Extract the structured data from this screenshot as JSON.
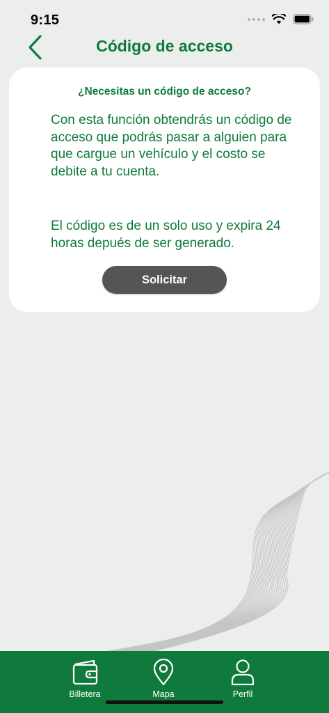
{
  "status_bar": {
    "time": "9:15"
  },
  "header": {
    "title": "Código de acceso",
    "back_icon": "chevron-left-icon"
  },
  "card": {
    "heading": "¿Necesitas un código de acceso?",
    "description_1": "Con esta función obtendrás un código de acceso que podrás pasar a alguien para que cargue un vehículo y el costo se debite a tu cuenta.",
    "description_2": "El código es de un solo uso y expira 24 horas depués de ser generado.",
    "button_label": "Solicitar"
  },
  "tab_bar": {
    "items": [
      {
        "label": "Billetera",
        "icon": "wallet-icon"
      },
      {
        "label": "Mapa",
        "icon": "map-pin-icon"
      },
      {
        "label": "Perfil",
        "icon": "user-icon"
      }
    ]
  },
  "colors": {
    "brand_green": "#0f7a3b",
    "background": "#eceeed",
    "button": "#555555"
  }
}
